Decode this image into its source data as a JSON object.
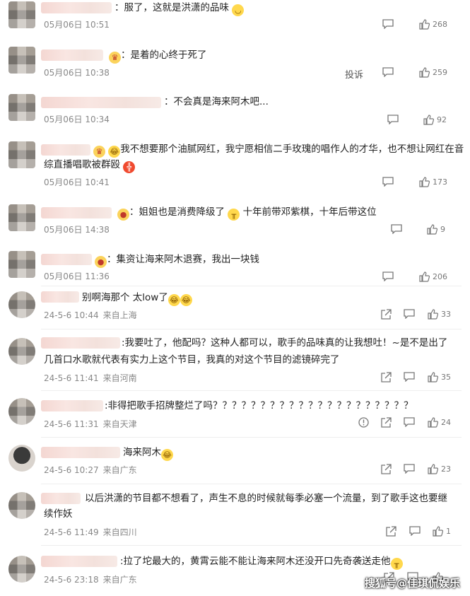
{
  "comments": [
    {
      "text": "：服了，这就是洪潇的品味",
      "date": "05月06日 10:51",
      "likes": "268"
    },
    {
      "text": "：是着的心终于死了",
      "date": "05月06日 10:38",
      "likes": "259",
      "report": "投诉"
    },
    {
      "text": "：不会真是海来阿木吧...",
      "date": "05月06日 10:34",
      "likes": "92"
    },
    {
      "text_line1": "我不想要那个油腻网红，我宁愿相信二手玫瑰的唱作人的才华，也不想让网红在音",
      "text_line2": "综直播唱歌被群殴",
      "date": "05月06日 10:41",
      "likes": "173"
    },
    {
      "text_a": "：姐姐也是消费降级了",
      "text_b": "十年前带邓紫棋，十年后带这位",
      "date": "05月06日 14:38",
      "likes": "9"
    },
    {
      "text": "：集资让海来阿木退赛，我出一块钱",
      "date": "05月06日 11:36",
      "likes": "206"
    },
    {
      "text": "别啊海那个 太low了",
      "date": "24-5-6 10:44",
      "location": "来自上海",
      "likes": "33"
    },
    {
      "text_line1": ":我要吐了，他配吗？这种人都可以，歌手的品味真的让我想吐！~是不是出了",
      "text_line2": "几首口水歌就代表有实力上这个节目，我真的对这个节目的滤镜碎完了",
      "date": "24-5-6 11:41",
      "location": "来自河南",
      "likes": "35"
    },
    {
      "text": ":非得把歌手招牌整烂了吗？？？？？？？？？？？？？？？？？？？？？",
      "date": "24-5-6 11:31",
      "location": "来自天津",
      "likes": "24"
    },
    {
      "text": "海来阿木",
      "date": "24-5-6 10:27",
      "location": "来自广东",
      "likes": "23"
    },
    {
      "text_line1": "以后洪潇的节目都不想看了，声生不息的时候就每季必塞一个流量，到了歌手这也要继",
      "text_line2": "续作妖",
      "date": "24-5-6 11:49",
      "location": "来自四川",
      "likes": "1"
    },
    {
      "text": ":拉了坨最大的，黄霄云能不能让海来阿木还没开口先奇袭送走他",
      "date": "24-5-6 23:18",
      "location": "来自广东"
    }
  ],
  "watermark": "搜狐号@佳琪侃娱乐",
  "icons": {
    "comment": "comment-icon",
    "like": "thumbs-up-icon",
    "share": "share-icon",
    "report": "report-icon"
  }
}
